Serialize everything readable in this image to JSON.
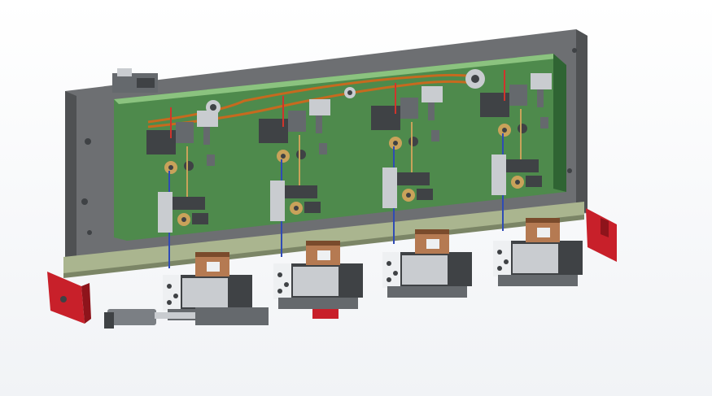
{
  "viewport": {
    "background_top": "#ffffff",
    "background_bottom": "#f1f3f6"
  },
  "model": {
    "subject": "cad-assembly-multi-station-fixture",
    "station_count": 4,
    "colors": {
      "base_plate": "#6d6f72",
      "base_plate_edge": "#4f5153",
      "mount_plate": "#4e8a4c",
      "mount_plate_light": "#8bc37f",
      "mount_plate_dark": "#2f6433",
      "rail": "#aab58f",
      "rail_dark": "#7b8566",
      "block_dark": "#3f4245",
      "block_mid": "#65696d",
      "block_light": "#c9ccd0",
      "block_white": "#eef0f2",
      "copper_block": "#b57a52",
      "copper_dark": "#7a4b2c",
      "end_stop": "#c8202a",
      "end_stop_dark": "#8e141b",
      "belt": "#c66a1f",
      "shaft_red": "#d0342c",
      "shaft_blue": "#2f4bb5",
      "brass": "#c9a25a",
      "cylinder": "#7b7f84"
    }
  }
}
